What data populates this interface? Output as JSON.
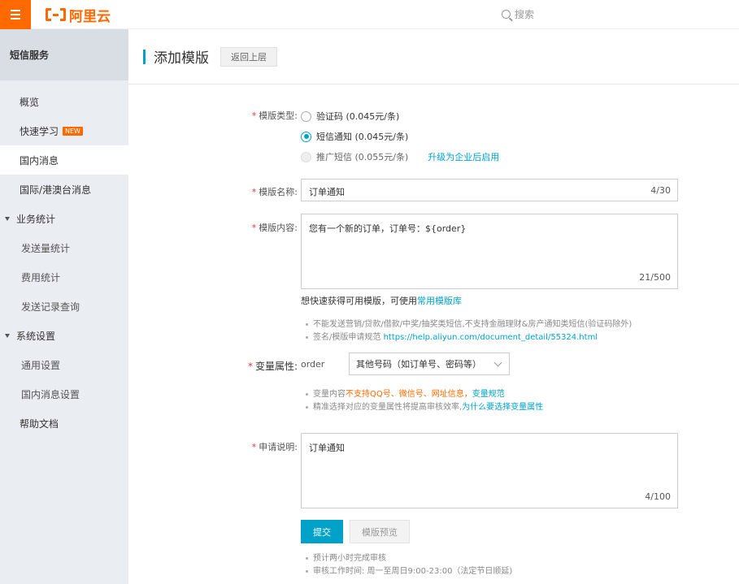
{
  "header": {
    "logo_text": "阿里云",
    "search_placeholder": "搜索",
    "accent_color": "#ff6a00"
  },
  "sidebar": {
    "title": "短信服务",
    "items": [
      {
        "label": "概览"
      },
      {
        "label": "快速学习",
        "badge": "NEW"
      },
      {
        "label": "国内消息",
        "active": true
      },
      {
        "label": "国际/港澳台消息"
      },
      {
        "label": "业务统计",
        "group": true
      },
      {
        "label": "发送量统计"
      },
      {
        "label": "费用统计"
      },
      {
        "label": "发送记录查询"
      },
      {
        "label": "系统设置",
        "group": true
      },
      {
        "label": "通用设置"
      },
      {
        "label": "国内消息设置"
      },
      {
        "label": "帮助文档"
      }
    ]
  },
  "page": {
    "title": "添加模版",
    "back_label": "返回上层"
  },
  "form": {
    "type_label": "模版类型:",
    "types": [
      {
        "label": "验证码 (0.045元/条)",
        "state": "unchecked"
      },
      {
        "label": "短信通知 (0.045元/条)",
        "state": "checked"
      },
      {
        "label": "推广短信 (0.055元/条)",
        "state": "disabled"
      }
    ],
    "upgrade_link": "升级为企业后启用",
    "name_label": "模版名称:",
    "name_value": "订单通知",
    "name_count": "4/30",
    "content_label": "模版内容:",
    "content_value": "您有一个新的订单，订单号：${order}",
    "content_count": "21/500",
    "library_prefix": "想快速获得可用模版，可使用",
    "library_link": "常用模版库",
    "rule1": "不能发送营销/贷款/借款/中奖/抽奖类短信,不支持金融理财&房产通知类短信(验证码除外)",
    "rule2_prefix": "签名/模版申请规范",
    "rule2_link": "https://help.aliyun.com/document_detail/55324.html",
    "var_label": "变量属性:",
    "var_name": "order",
    "var_select": "其他号码（如订单号、密码等）",
    "var_hint1_prefix": "变量内容",
    "var_hint1_warn": "不支持QQ号、微信号、网址信息，",
    "var_hint1_link": "变量规范",
    "var_hint2_prefix": "精准选择对应的变量属性将提高审核效率,",
    "var_hint2_link": "为什么要选择变量属性",
    "remark_label": "申请说明:",
    "remark_value": "订单通知",
    "remark_count": "4/100",
    "submit_label": "提交",
    "preview_label": "模版预览",
    "note1": "预计两小时完成审核",
    "note2": "审核工作时间: 周一至周日9:00-23:00（法定节日顺延)"
  }
}
